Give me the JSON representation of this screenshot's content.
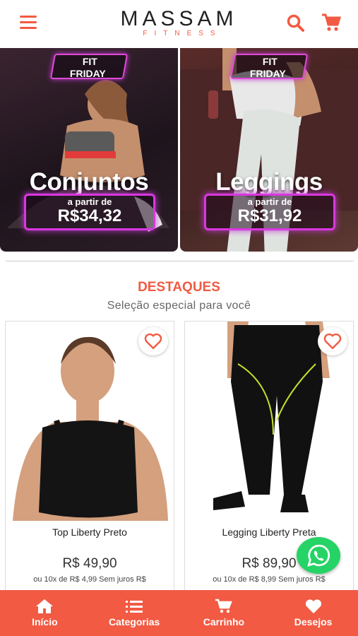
{
  "header": {
    "brand": "MASSAM",
    "brand_sub": "FITNESS"
  },
  "banners": [
    {
      "badge_line1": "FIT",
      "badge_line2": "FRIDAY",
      "title": "Conjuntos",
      "from_label": "a partir de",
      "price": "R$34,32"
    },
    {
      "badge_line1": "FIT",
      "badge_line2": "FRIDAY",
      "title": "Leggings",
      "from_label": "a partir de",
      "price": "R$31,92"
    }
  ],
  "section": {
    "title": "DESTAQUES",
    "subtitle": "Seleção especial para você"
  },
  "products": [
    {
      "name": "Top Liberty Preto",
      "price": "R$ 49,90",
      "installments": "ou 10x de R$ 4,99 Sem juros R$"
    },
    {
      "name": "Legging Liberty Preta",
      "price": "R$ 89,90",
      "installments": "ou 10x de R$ 8,99 Sem juros R$"
    }
  ],
  "bottom_nav": [
    {
      "label": "Início",
      "icon": "home-icon"
    },
    {
      "label": "Categorias",
      "icon": "list-icon"
    },
    {
      "label": "Carrinho",
      "icon": "cart-icon"
    },
    {
      "label": "Desejos",
      "icon": "heart-icon"
    }
  ],
  "colors": {
    "accent": "#f25a43",
    "whatsapp": "#25d366",
    "banner_glow": "#d838e0"
  }
}
